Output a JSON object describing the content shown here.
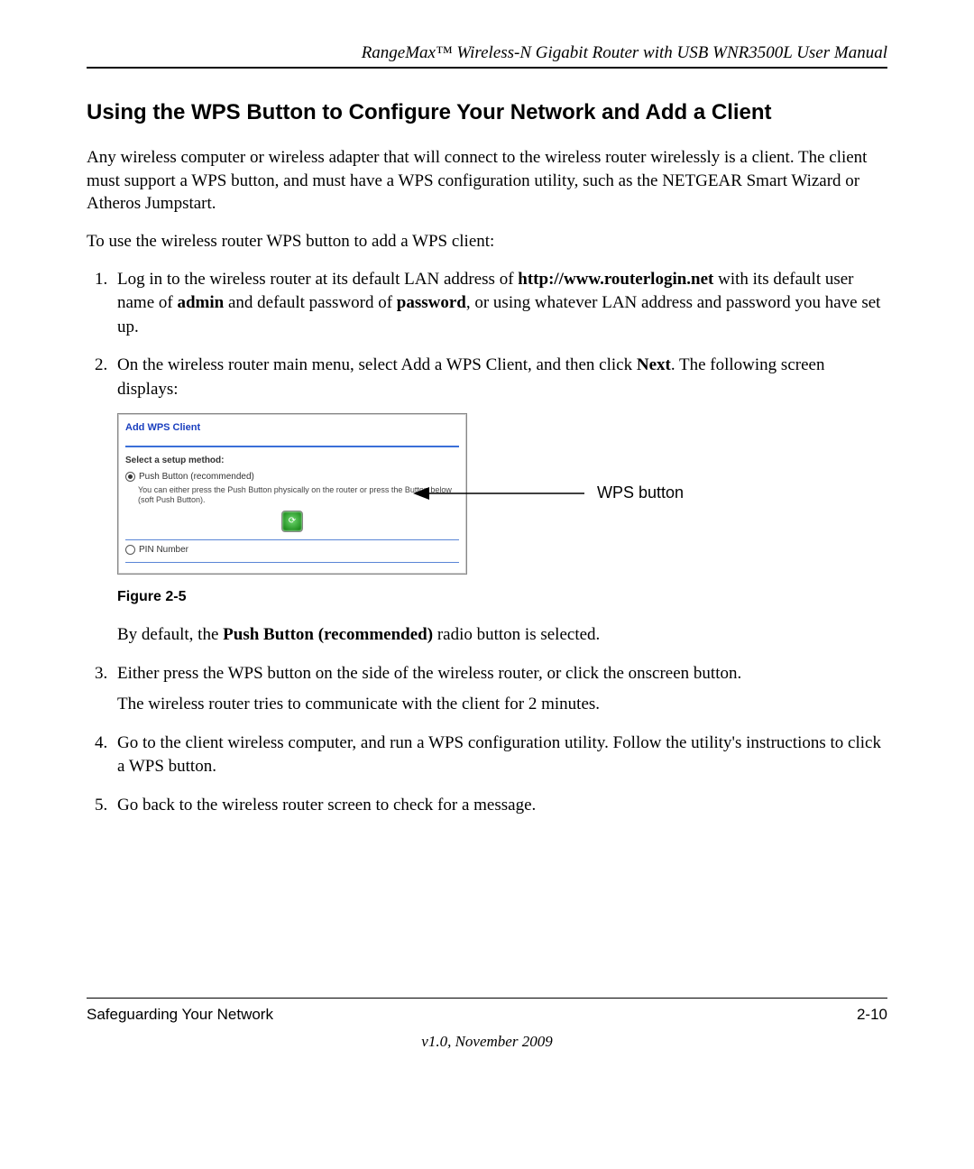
{
  "header": {
    "manual_title": "RangeMax™ Wireless-N Gigabit Router with USB WNR3500L User Manual"
  },
  "section": {
    "heading": "Using the WPS Button to Configure Your Network and Add a Client",
    "intro": "Any wireless computer or wireless adapter that will connect to the wireless router wirelessly is a client. The client must support a WPS button, and must have a WPS configuration utility, such as the NETGEAR Smart Wizard or Atheros Jumpstart.",
    "lead_in": "To use the wireless router WPS button to add a WPS client:"
  },
  "steps": {
    "s1_a": "Log in to the wireless router at its default LAN address of ",
    "s1_b_bold": "http://www.routerlogin.net",
    "s1_c": " with its default user name of ",
    "s1_d_bold": "admin",
    "s1_e": " and default password of ",
    "s1_f_bold": "password",
    "s1_g": ", or using whatever LAN address and password you have set up.",
    "s2_a": "On the wireless router main menu, select Add a WPS Client, and then click ",
    "s2_b_bold": "Next",
    "s2_c": ". The following screen displays:",
    "s2_after_a": "By default, the ",
    "s2_after_b_bold": "Push Button (recommended)",
    "s2_after_c": " radio button is selected.",
    "s3_a": "Either press the WPS button on the side of the wireless router, or click the onscreen button.",
    "s3_b": "The wireless router tries to communicate with the client for 2 minutes.",
    "s4": "Go to the client wireless computer, and run a WPS configuration utility. Follow the utility's instructions to click a WPS button.",
    "s5": "Go back to the wireless router screen to check for a message."
  },
  "dialog": {
    "title": "Add WPS Client",
    "section_label": "Select a setup method:",
    "option_push": "Push Button (recommended)",
    "hint": "You can either press the Push Button physically on the router or press the Button below (soft Push Button).",
    "option_pin": "PIN Number",
    "callout": "WPS button"
  },
  "figure": {
    "caption": "Figure 2-5"
  },
  "footer": {
    "left": "Safeguarding Your Network",
    "right": "2-10",
    "version": "v1.0, November 2009"
  }
}
